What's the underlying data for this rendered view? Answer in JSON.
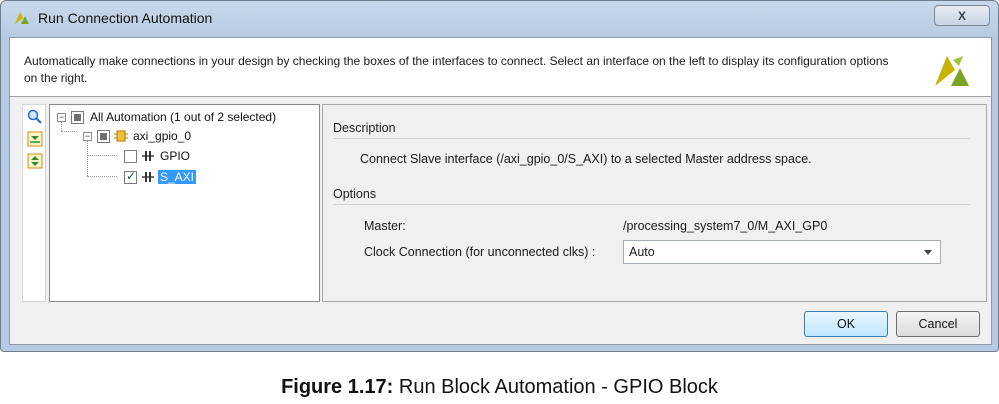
{
  "window": {
    "title": "Run Connection Automation",
    "close_label": "X"
  },
  "info": {
    "text": "Automatically make connections in your design by checking the boxes of the interfaces to connect. Select an interface on the left to display its configuration options on the right."
  },
  "tree": {
    "root": {
      "label": "All Automation (1 out of 2 selected)",
      "expanded": true,
      "state": "partial"
    },
    "block": {
      "label": "axi_gpio_0",
      "expanded": true,
      "state": "partial"
    },
    "items": [
      {
        "label": "GPIO",
        "checked": false,
        "selected": false
      },
      {
        "label": "S_AXI",
        "checked": true,
        "selected": true
      }
    ]
  },
  "panel": {
    "description_header": "Description",
    "description_text": "Connect Slave interface (/axi_gpio_0/S_AXI) to a selected Master address space.",
    "options_header": "Options",
    "master_label": "Master:",
    "master_value": "/processing_system7_0/M_AXI_GP0",
    "clock_label": "Clock Connection (for unconnected clks) :",
    "clock_value": "Auto"
  },
  "buttons": {
    "ok": "OK",
    "cancel": "Cancel"
  },
  "caption": {
    "bold": "Figure 1.17:",
    "text": " Run Block Automation - GPIO Block"
  },
  "colors": {
    "selection": "#3399ff",
    "accent_yellow": "#c8b400",
    "accent_green": "#7aa520"
  }
}
